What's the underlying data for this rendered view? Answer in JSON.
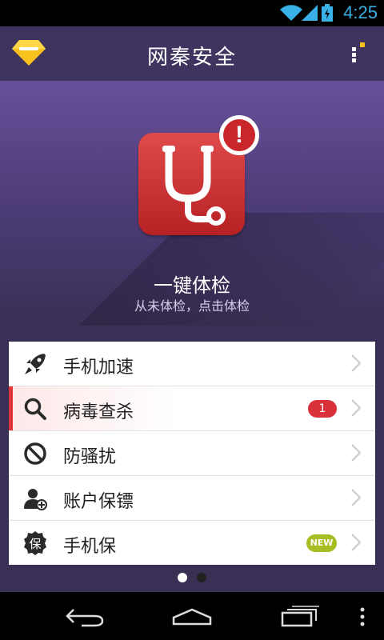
{
  "status_bar": {
    "time": "4:25"
  },
  "header": {
    "title": "网秦安全"
  },
  "hero": {
    "title": "一键体检",
    "subtitle": "从未体检，点击体检",
    "alert_mark": "!"
  },
  "menu": [
    {
      "label": "手机加速",
      "icon": "rocket-icon"
    },
    {
      "label": "病毒查杀",
      "icon": "search-icon",
      "badge": "1"
    },
    {
      "label": "防骚扰",
      "icon": "block-icon"
    },
    {
      "label": "账户保镖",
      "icon": "user-shield-icon"
    },
    {
      "label": "手机保",
      "icon": "bao-icon",
      "badge_new": "NEW",
      "icon_text": "保"
    }
  ],
  "colors": {
    "accent_red": "#e0353a",
    "header": "#3f3460",
    "new_badge": "#a8bd21"
  }
}
